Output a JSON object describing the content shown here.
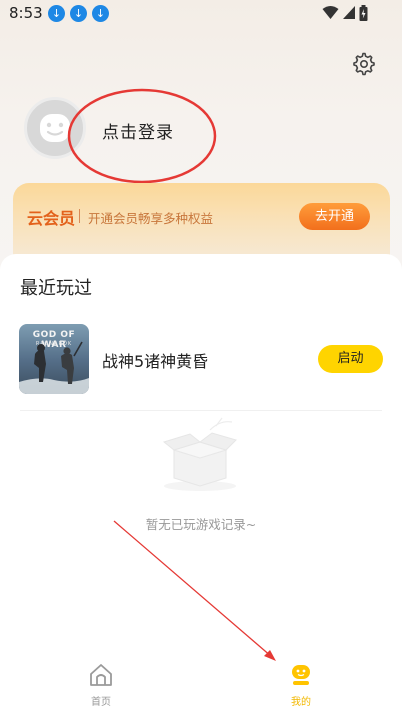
{
  "status_bar": {
    "time": "8:53",
    "download_icons": [
      "download-icon",
      "download-icon",
      "download-icon"
    ]
  },
  "profile": {
    "login_label": "点击登录"
  },
  "vip": {
    "title": "云会员",
    "description": "开通会员畅享多种权益",
    "button_label": "去开通"
  },
  "recent": {
    "title": "最近玩过",
    "games": [
      {
        "name": "战神5诸神黄昏",
        "cover_title": "GOD OF WAR",
        "cover_subtitle": "RAGNARÖK",
        "action_label": "启动"
      }
    ],
    "empty_text": "暂无已玩游戏记录~"
  },
  "tabbar": {
    "tabs": [
      {
        "label": "首页",
        "icon": "home-icon",
        "active": false
      },
      {
        "label": "我的",
        "icon": "mine-icon",
        "active": true
      }
    ]
  },
  "colors": {
    "accent_orange": "#f26f1c",
    "launch_yellow": "#ffd400",
    "active_tab": "#f2b800",
    "annotation_red": "#e53935"
  }
}
